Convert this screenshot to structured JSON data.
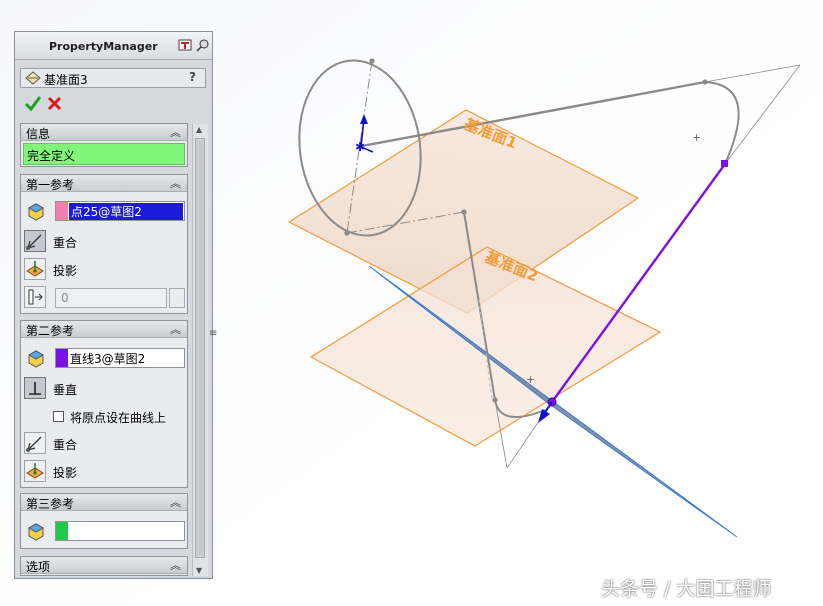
{
  "property_manager": {
    "title": "PropertyManager",
    "feature_name": "基准面3",
    "help": "?",
    "groups": {
      "info": {
        "header": "信息",
        "message": "完全定义"
      },
      "first_ref": {
        "header": "第一参考",
        "selection": "点25@草图2",
        "swatch_color": "#f27fb0",
        "option_coincident": "重合",
        "option_project": "投影",
        "distance_value": "0"
      },
      "second_ref": {
        "header": "第二参考",
        "selection": "直线3@草图2",
        "swatch_color": "#7a12e8",
        "option_perpendicular": "垂直",
        "checkbox_origin_on_curve": "将原点设在曲线上",
        "option_coincident": "重合",
        "option_project": "投影"
      },
      "third_ref": {
        "header": "第三参考",
        "selection": "",
        "swatch_color": "#1ec94a"
      },
      "options": {
        "header": "选项"
      }
    }
  },
  "graphics": {
    "plane1_label": "基准面1",
    "plane2_label": "基准面2",
    "colors": {
      "plane_edge": "#f29b3a",
      "plane_fill": "#f5d9c0",
      "new_plane_fill": "#6d7f96",
      "sketch": "#8a8a8a",
      "selected_line": "#7a12e8",
      "axis": "#1212d4"
    }
  },
  "watermark": "头条号 / 大国工程师"
}
